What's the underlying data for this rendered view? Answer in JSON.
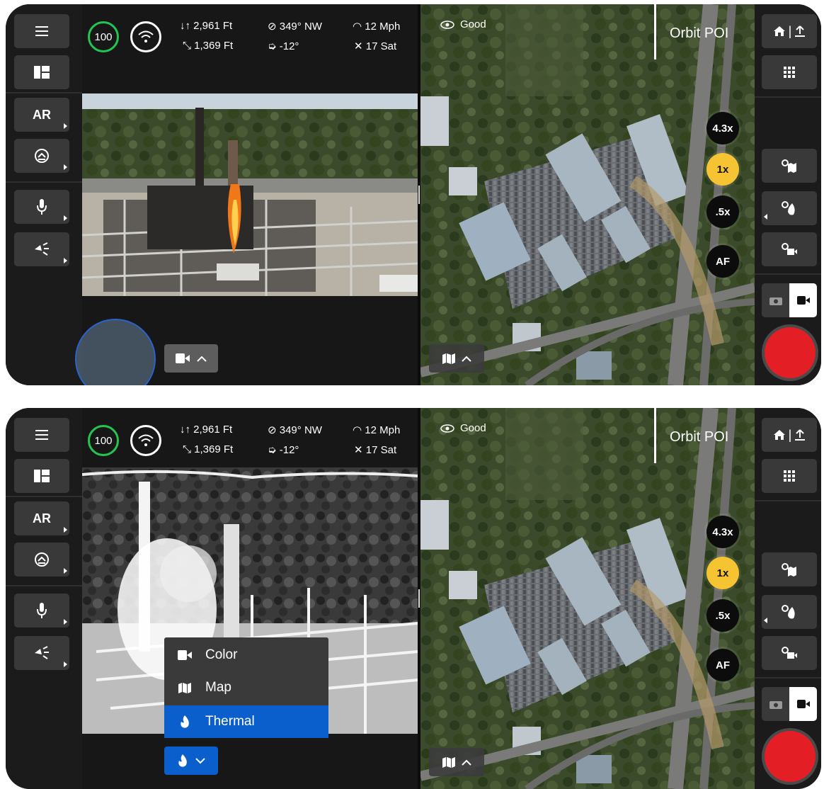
{
  "telemetry": {
    "battery": "100",
    "altitude": "2,961 Ft",
    "distance": "1,369 Ft",
    "heading": "349° NW",
    "gimbal_pitch": "-12°",
    "speed": "12 Mph",
    "satellites": "17 Sat"
  },
  "left_sidebar": {
    "ar_label": "AR",
    "icons": [
      "menu-icon",
      "layout-icon",
      "ar-icon",
      "obstacle-icon",
      "microphone-icon",
      "spotlight-icon"
    ]
  },
  "map": {
    "signal_label": "Good",
    "mode_label": "Orbit POI",
    "zoom_levels": [
      "4.3x",
      "1x",
      ".5x"
    ],
    "focus_label": "AF",
    "active_zoom": "1x"
  },
  "right_sidebar": {
    "icons": [
      "home-icon",
      "upload-icon",
      "grid-icon",
      "map-settings-icon",
      "thermal-settings-icon",
      "camera-settings-icon",
      "photo-mode-icon",
      "video-mode-icon",
      "record-button"
    ]
  },
  "camera_menu": {
    "items": [
      {
        "label": "Color",
        "icon": "video-icon",
        "selected": false
      },
      {
        "label": "Map",
        "icon": "map-icon",
        "selected": false
      },
      {
        "label": "Thermal",
        "icon": "flame-icon",
        "selected": true
      }
    ]
  },
  "colors": {
    "battery_ring": "#23c552",
    "zoom_active": "#f6c432",
    "menu_selected": "#0a5fcc",
    "record": "#e31e24",
    "highlight_ring": "#2a63c9"
  },
  "panels": [
    "color-view",
    "thermal-view-with-menu"
  ]
}
